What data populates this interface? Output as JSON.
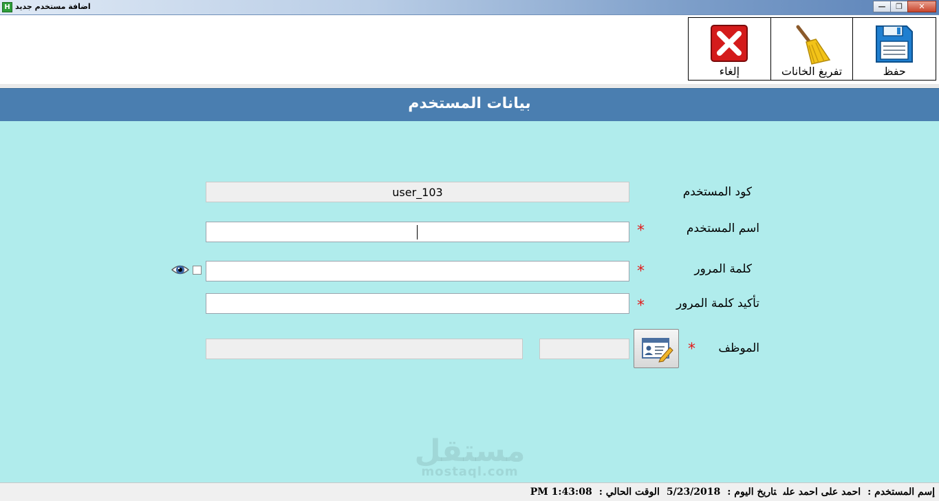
{
  "window": {
    "title": "اضافة مستخدم جديد",
    "app_icon_letter": "H",
    "minimize_glyph": "—",
    "restore_glyph": "❐",
    "close_glyph": "✕"
  },
  "toolbar": {
    "save_label": "حفظ",
    "clear_label": "تفريغ الخانات",
    "cancel_label": "إلغاء"
  },
  "form": {
    "header_title": "بيانات المستخدم",
    "user_code_label": "كود المستخدم",
    "user_code_value": "user_103",
    "username_label": "اسم المستخدم",
    "password_label": "كلمة المرور",
    "confirm_password_label": "تأكيد كلمة المرور",
    "employee_label": "الموظف",
    "required_mark": "*"
  },
  "watermark": {
    "arabic": "مستقل",
    "latin": "mostaql.com"
  },
  "status": {
    "user_label": "إسم المستخدم :",
    "user_value": "احمد على احمد على",
    "date_label": "تاريخ اليوم :",
    "date_value": "5/23/2018",
    "time_label": "الوقت الحالي :",
    "time_value": "1:43:08 PM"
  }
}
